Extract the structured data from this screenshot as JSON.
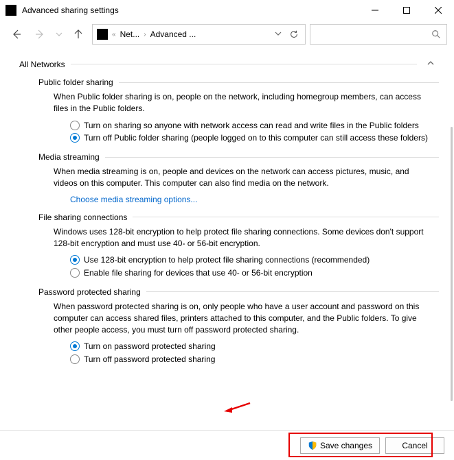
{
  "window": {
    "title": "Advanced sharing settings"
  },
  "breadcrumb": {
    "seg1": "Net...",
    "seg2": "Advanced ..."
  },
  "profile": {
    "label": "All Networks"
  },
  "publicFolder": {
    "header": "Public folder sharing",
    "desc": "When Public folder sharing is on, people on the network, including homegroup members, can access files in the Public folders.",
    "opt1": "Turn on sharing so anyone with network access can read and write files in the Public folders",
    "opt2": "Turn off Public folder sharing (people logged on to this computer can still access these folders)"
  },
  "mediaStreaming": {
    "header": "Media streaming",
    "desc": "When media streaming is on, people and devices on the network can access pictures, music, and videos on this computer. This computer can also find media on the network.",
    "link": "Choose media streaming options..."
  },
  "fileSharing": {
    "header": "File sharing connections",
    "desc": "Windows uses 128-bit encryption to help protect file sharing connections. Some devices don't support 128-bit encryption and must use 40- or 56-bit encryption.",
    "opt1": "Use 128-bit encryption to help protect file sharing connections (recommended)",
    "opt2": "Enable file sharing for devices that use 40- or 56-bit encryption"
  },
  "passwordProtected": {
    "header": "Password protected sharing",
    "desc": "When password protected sharing is on, only people who have a user account and password on this computer can access shared files, printers attached to this computer, and the Public folders. To give other people access, you must turn off password protected sharing.",
    "opt1": "Turn on password protected sharing",
    "opt2": "Turn off password protected sharing"
  },
  "buttons": {
    "save": "Save changes",
    "cancel": "Cancel"
  }
}
